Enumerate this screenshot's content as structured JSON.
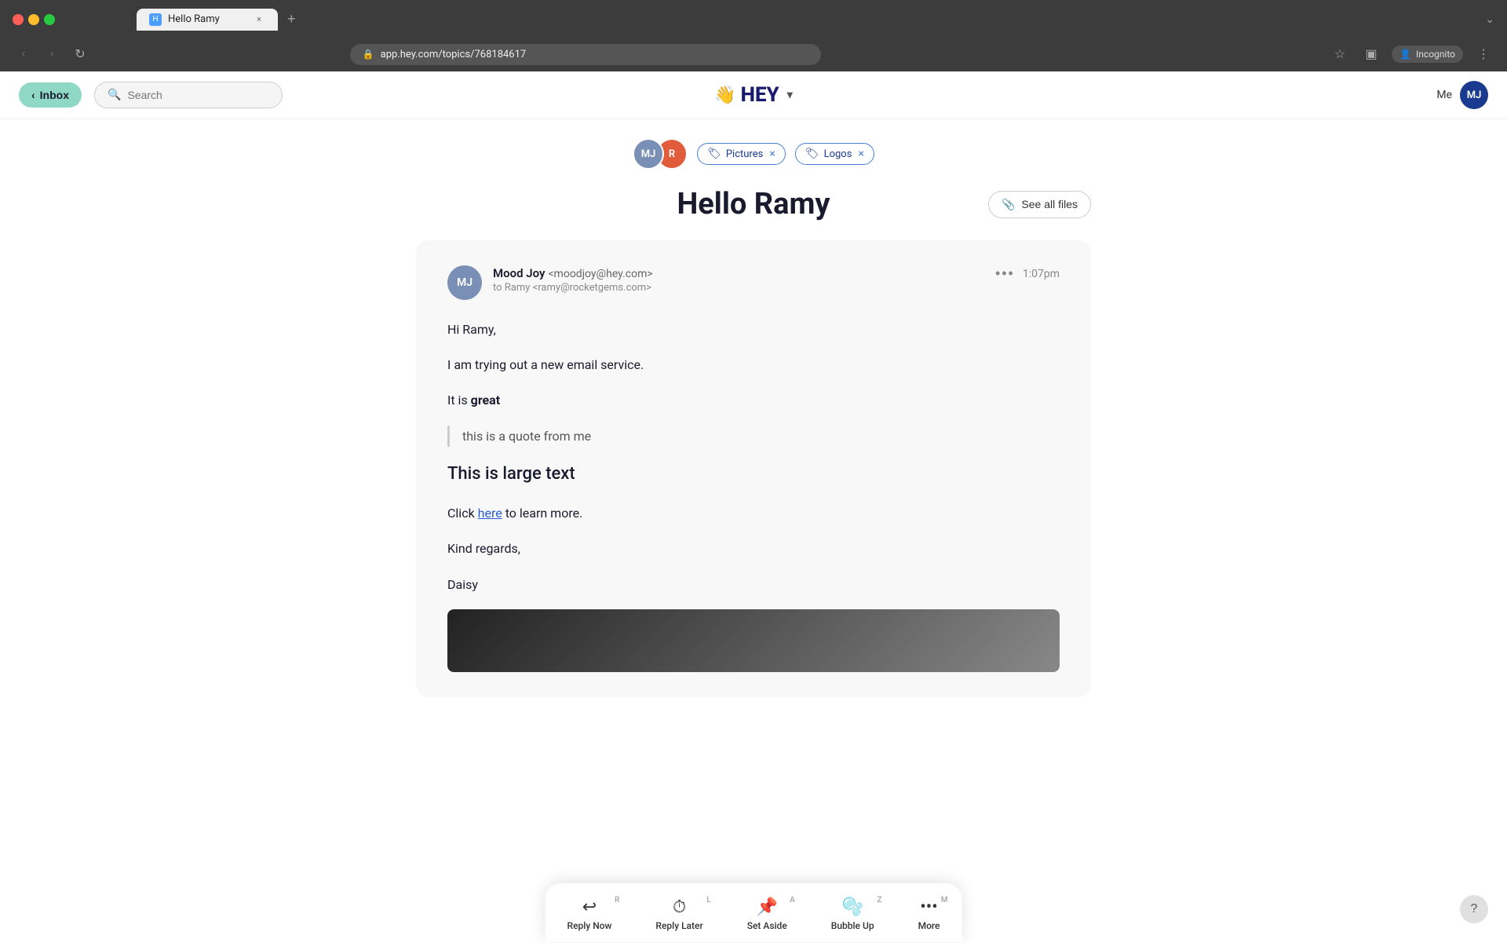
{
  "browser": {
    "tab_title": "Hello Ramy",
    "url": "app.hey.com/topics/768184617",
    "tab_close_label": "×",
    "new_tab_label": "+",
    "expand_label": "⌄",
    "nav_back": "‹",
    "nav_forward": "›",
    "nav_reload": "↻",
    "lock_icon": "🔒",
    "incognito_label": "Incognito",
    "bookmark_icon": "☆",
    "sidebar_icon": "▣",
    "menu_icon": "⋮",
    "user_icon": "👤"
  },
  "header": {
    "inbox_label": "Inbox",
    "inbox_back_arrow": "‹",
    "search_placeholder": "Search",
    "hey_logo": "HEY",
    "hey_wave": "👋",
    "chevron": "▾",
    "user_label": "Me",
    "user_initials": "MJ"
  },
  "topic": {
    "participant1_initials": "MJ",
    "participant2_initials": "R",
    "tag1_label": "Pictures",
    "tag1_icon": "🏷",
    "tag2_label": "Logos",
    "tag2_icon": "🏷",
    "title": "Hello Ramy",
    "see_all_files_label": "See all files",
    "paperclip_icon": "📎"
  },
  "email": {
    "sender_initials": "MJ",
    "sender_name": "Mood Joy",
    "sender_email": "<moodjoy@hey.com>",
    "to_line": "to Ramy <ramy@rocketgems.com>",
    "time": "1:07pm",
    "dots": "•••",
    "body": {
      "greeting": "Hi Ramy,",
      "line1": "I am trying out a new email service.",
      "line2_prefix": "It is ",
      "line2_bold": "great",
      "blockquote": "this is a quote from me",
      "large_text": "This is large text",
      "line3_prefix": "Click ",
      "line3_link": "here",
      "line3_suffix": " to learn more.",
      "closing": "Kind regards,",
      "signature": "Daisy"
    }
  },
  "actions": {
    "reply_now_label": "Reply Now",
    "reply_now_icon": "↩",
    "reply_now_shortcut": "R",
    "reply_later_label": "Reply Later",
    "reply_later_icon": "⏱",
    "reply_later_shortcut": "L",
    "set_aside_label": "Set Aside",
    "set_aside_icon": "📌",
    "set_aside_shortcut": "A",
    "bubble_up_label": "Bubble Up",
    "bubble_up_icon": "🫧",
    "bubble_up_shortcut": "Z",
    "more_label": "More",
    "more_icon": "•••",
    "more_shortcut": "M"
  },
  "help": {
    "label": "?"
  }
}
